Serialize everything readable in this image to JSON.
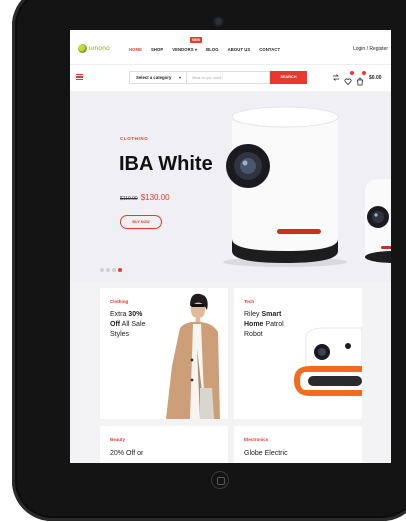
{
  "site": {
    "logo_text": "umono"
  },
  "nav": {
    "items": [
      "HOME",
      "SHOP",
      "VENDORS ▾",
      "BLOG",
      "ABOUT US",
      "CONTACT"
    ],
    "new_badge": "NEW",
    "login": "Login / Register"
  },
  "search": {
    "category": "Select a category",
    "placeholder": "What do you need?",
    "button": "SEARCH"
  },
  "header_icons": {
    "cart_total": "$0.00"
  },
  "hero": {
    "category": "CLOTHING",
    "title": "IBA White",
    "old_price": "$110.00",
    "price": "$130.00",
    "button": "BUY NOW",
    "active_slide": 4,
    "slide_count": 4
  },
  "promos": [
    {
      "category": "Clothing",
      "l1a": "Extra ",
      "l1b": "30%",
      "l2a": "Off",
      "l2b": " All Sale",
      "l3": "Styles"
    },
    {
      "category": "Tech",
      "l1a": "Riley ",
      "l1b": "Smart",
      "l2a": "Home",
      "l2b": " Patrol",
      "l3": "Robot"
    },
    {
      "category": "Beauty",
      "l1a": "20% Off or",
      "l1b": "",
      "l2a": "",
      "l2b": "",
      "l3": ""
    },
    {
      "category": "Electronics",
      "l1a": "Globe Electric",
      "l1b": "",
      "l2a": "",
      "l2b": "",
      "l3": ""
    }
  ],
  "colors": {
    "accent": "#e8392c",
    "logo": "#8aa82c",
    "bezel": "#141414"
  }
}
